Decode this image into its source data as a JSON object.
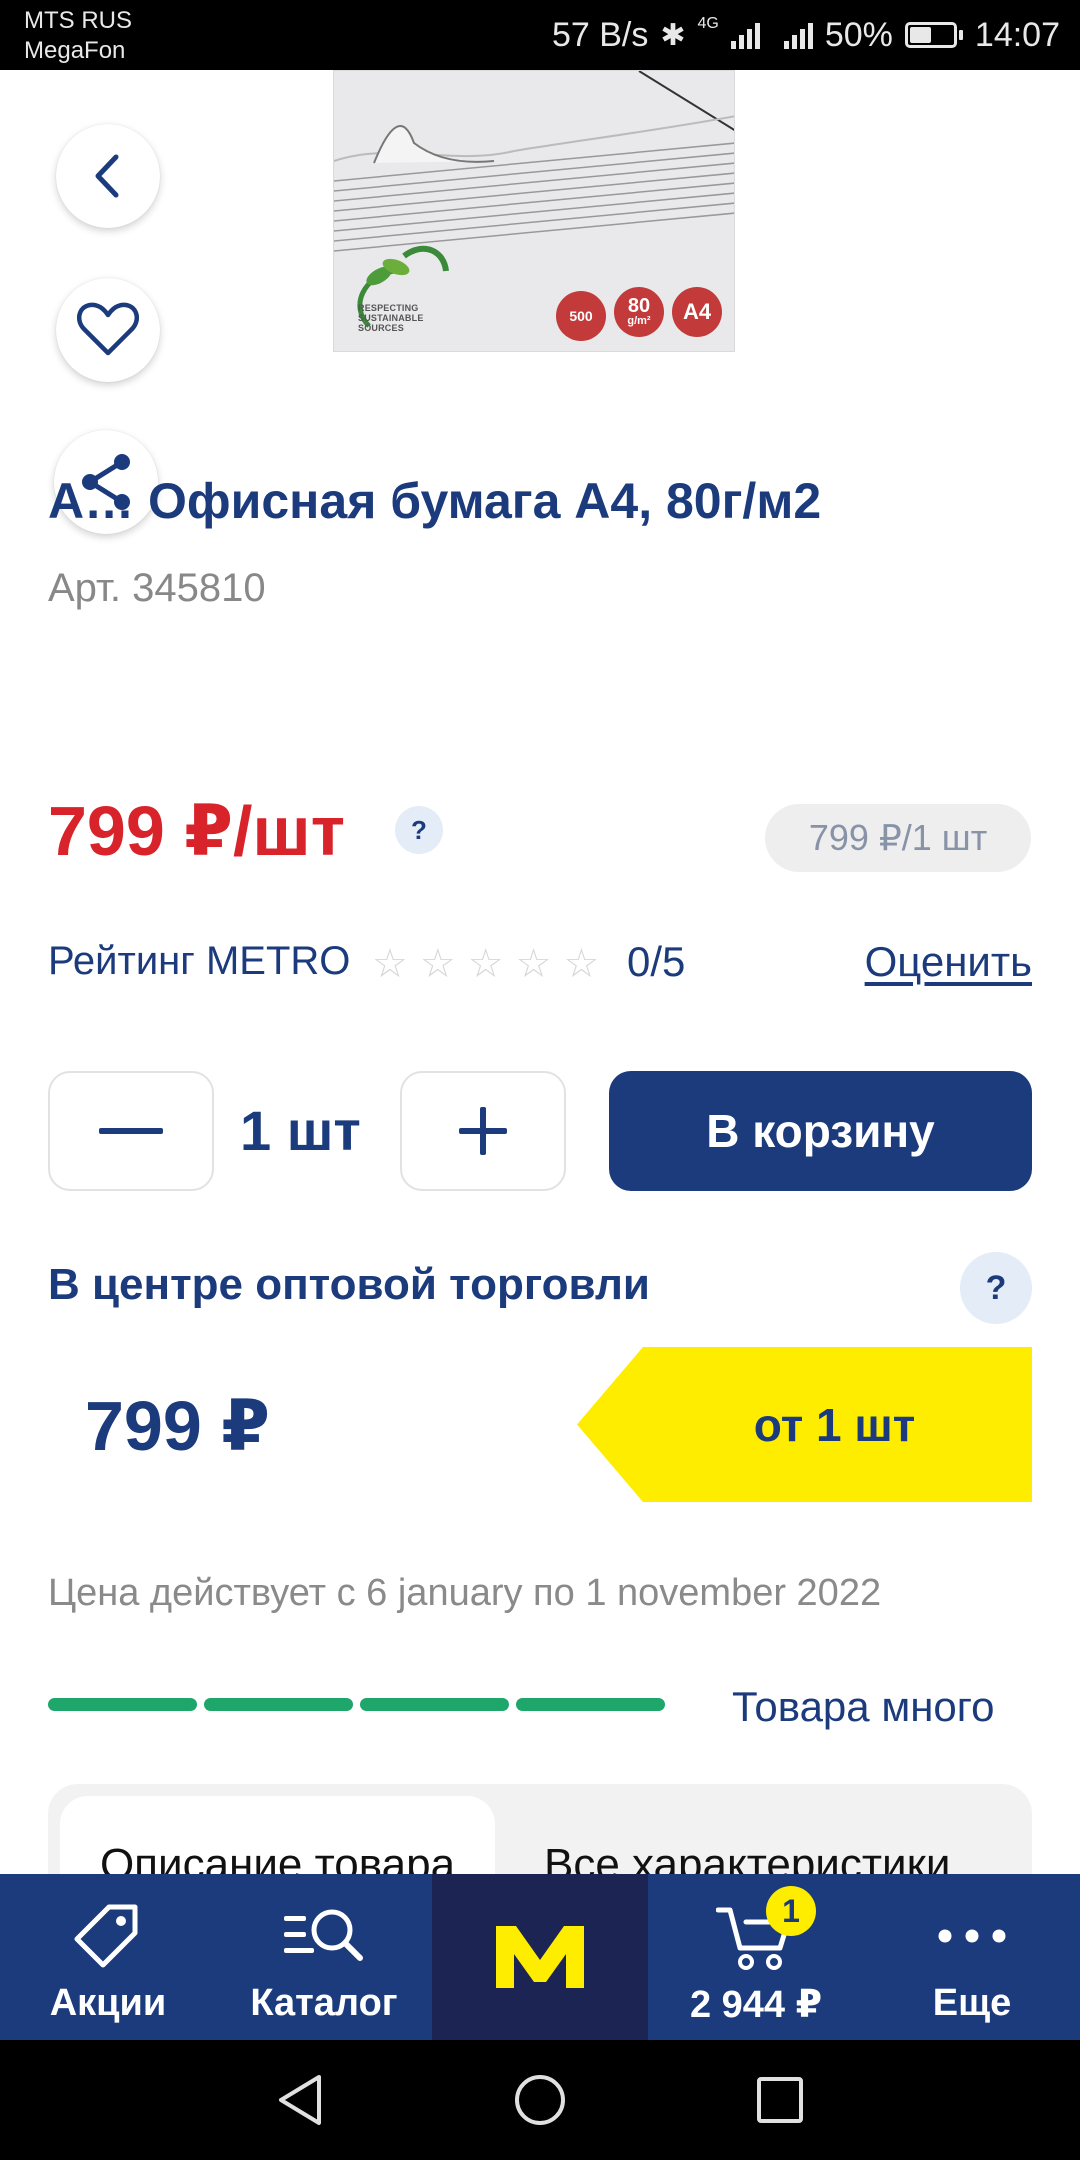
{
  "status_bar": {
    "carrier_1": "MTS RUS",
    "carrier_2": "MegaFon",
    "net_speed": "57 B/s",
    "network_type": "4G",
    "battery": "50%",
    "time": "14:07"
  },
  "product_image": {
    "badge_count": "500",
    "badge_weight": "80",
    "badge_weight_unit": "g/m²",
    "badge_format": "A4",
    "leaf_text_1": "RESPECTING",
    "leaf_text_2": "SUSTAINABLE",
    "leaf_text_3": "SOURCES"
  },
  "product": {
    "title": "A… Офисная бумага A4, 80г/м2",
    "article": "Арт. 345810"
  },
  "price": {
    "main": "799 ₽/шт",
    "help": "?",
    "per_unit": "799 ₽/1 шт"
  },
  "rating": {
    "label": "Рейтинг METRO",
    "stars": [
      "☆",
      "☆",
      "☆",
      "☆",
      "☆"
    ],
    "value": "0/5",
    "rate_link": "Оценить"
  },
  "quantity": {
    "minus": "—",
    "value": "1 шт",
    "plus": "+",
    "add_to_cart": "В корзину"
  },
  "wholesale": {
    "title": "В центре оптовой торговли",
    "help": "?",
    "price": "799 ₽",
    "tier": "от 1 шт",
    "validity": "Цена действует с 6 january по 1 november 2022"
  },
  "stock": {
    "level_fraction": 1.0,
    "segments": 4,
    "text": "Товара много",
    "color": "#1ea66b"
  },
  "tabs": [
    {
      "label": "Описание товара"
    },
    {
      "label": "Все характеристики"
    }
  ],
  "bottom_nav": {
    "promo": "Акции",
    "catalog": "Каталог",
    "logo": "M",
    "cart_count": "1",
    "cart_total": "2 944 ₽",
    "more": "Еще"
  },
  "icons": {
    "back": "chevron-left-icon",
    "favorite": "heart-icon",
    "share": "share-icon",
    "promo": "tag-icon",
    "catalog": "search-list-icon",
    "cart": "cart-icon",
    "more": "dots-icon"
  },
  "colors": {
    "brand_blue": "#1b3b7d",
    "price_red": "#d8232a",
    "accent_yellow": "#ffed00",
    "logo_bg": "#1b2452"
  }
}
